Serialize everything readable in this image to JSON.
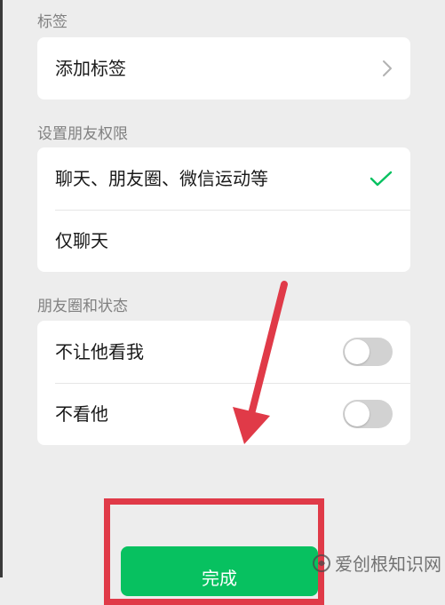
{
  "sections": {
    "tags": {
      "label": "标签",
      "add_tag_label": "添加标签",
      "chevron_icon": "chevron-right-icon"
    },
    "permissions": {
      "label": "设置朋友权限",
      "options": [
        {
          "label": "聊天、朋友圈、微信运动等",
          "selected": true
        },
        {
          "label": "仅聊天",
          "selected": false
        }
      ],
      "check_icon": "checkmark-icon"
    },
    "moments": {
      "label": "朋友圈和状态",
      "toggles": [
        {
          "label": "不让他看我",
          "on": false
        },
        {
          "label": "不看他",
          "on": false
        }
      ]
    }
  },
  "done_button": {
    "label": "完成"
  },
  "annotation": {
    "arrow_icon": "arrow-down-icon",
    "color": "#e03a48"
  },
  "watermark": {
    "text": "爱创根知识网"
  },
  "colors": {
    "background": "#ededed",
    "card": "#ffffff",
    "accent": "#07c160",
    "toggle_off": "#d2d2d2",
    "secondary_text": "#808080"
  }
}
